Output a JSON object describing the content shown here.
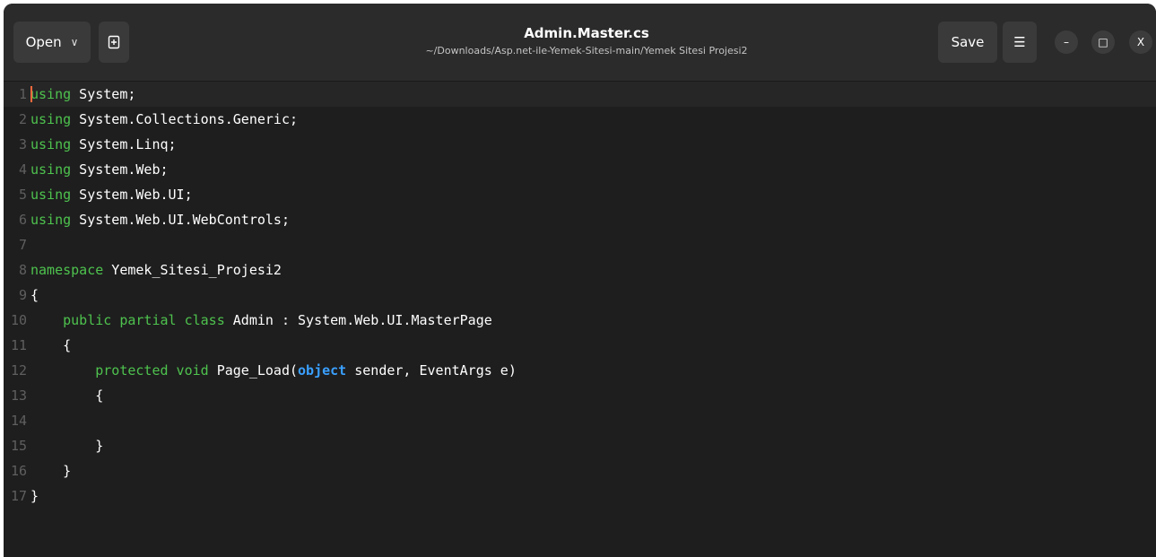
{
  "header": {
    "open_label": "Open",
    "open_chevron": "∨",
    "new_tab_icon": "new-tab-icon",
    "title": "Admin.Master.cs",
    "subtitle": "~/Downloads/Asp.net-ile-Yemek-Sitesi-main/Yemek Sitesi Projesi2",
    "save_label": "Save",
    "menu_glyph": "☰",
    "minimize_glyph": "–",
    "maximize_glyph": "□",
    "close_glyph": "X"
  },
  "colors": {
    "keyword": "#4ec24e",
    "type_keyword": "#3aa0ff",
    "background": "#1e1e1e",
    "header": "#2b2b2b",
    "caret": "#ff6a3d"
  },
  "editor": {
    "current_line": 1,
    "lines": [
      {
        "n": "1",
        "indent": "",
        "kw": "using",
        "rest": " System;"
      },
      {
        "n": "2",
        "indent": "",
        "kw": "using",
        "rest": " System.Collections.Generic;"
      },
      {
        "n": "3",
        "indent": "",
        "kw": "using",
        "rest": " System.Linq;"
      },
      {
        "n": "4",
        "indent": "",
        "kw": "using",
        "rest": " System.Web;"
      },
      {
        "n": "5",
        "indent": "",
        "kw": "using",
        "rest": " System.Web.UI;"
      },
      {
        "n": "6",
        "indent": "",
        "kw": "using",
        "rest": " System.Web.UI.WebControls;"
      },
      {
        "n": "7",
        "indent": "",
        "kw": "",
        "rest": ""
      },
      {
        "n": "8",
        "indent": "",
        "kw": "namespace",
        "rest": " Yemek_Sitesi_Projesi2"
      },
      {
        "n": "9",
        "indent": "",
        "kw": "",
        "rest": "{"
      },
      {
        "n": "10",
        "indent": "    ",
        "kw": "public partial class",
        "rest": " Admin : System.Web.UI.MasterPage"
      },
      {
        "n": "11",
        "indent": "    ",
        "kw": "",
        "rest": "{"
      },
      {
        "n": "12",
        "indent": "        ",
        "kw": "protected void",
        "rest": " Page_Load(",
        "type_kw": "object",
        "rest2": " sender, EventArgs e)"
      },
      {
        "n": "13",
        "indent": "        ",
        "kw": "",
        "rest": "{"
      },
      {
        "n": "14",
        "indent": "",
        "kw": "",
        "rest": ""
      },
      {
        "n": "15",
        "indent": "        ",
        "kw": "",
        "rest": "}"
      },
      {
        "n": "16",
        "indent": "    ",
        "kw": "",
        "rest": "}"
      },
      {
        "n": "17",
        "indent": "",
        "kw": "",
        "rest": "}"
      }
    ]
  }
}
